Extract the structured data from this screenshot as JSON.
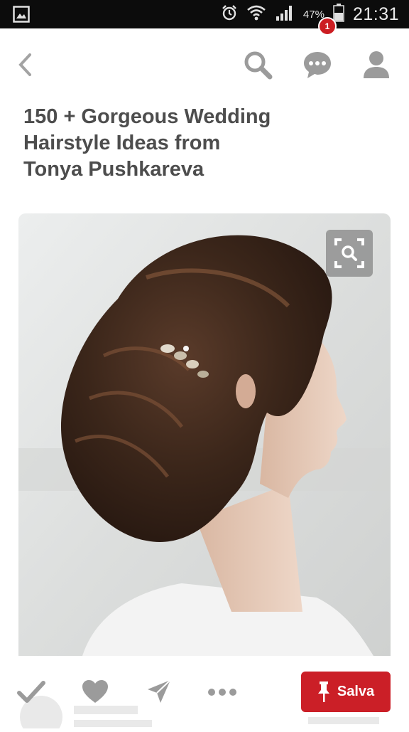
{
  "status_bar": {
    "battery": "47%",
    "time": "21:31"
  },
  "nav": {
    "notification_count": "1"
  },
  "pin": {
    "title_lines": [
      "150 + Gorgeous Wedding",
      "Hairstyle Ideas from",
      "Tonya Pushkareva"
    ]
  },
  "actions": {
    "save_label": "Salva"
  },
  "colors": {
    "accent": "#cb1f27",
    "icon_gray": "#9b9b9b",
    "title_gray": "#4d4d4d"
  },
  "icons": [
    "gallery-icon",
    "alarm-icon",
    "wifi-icon",
    "signal-icon",
    "battery-icon",
    "back-icon",
    "search-icon",
    "messages-icon",
    "profile-icon",
    "visual-search-icon",
    "check-icon",
    "heart-icon",
    "send-icon",
    "more-icon",
    "pin-icon"
  ]
}
